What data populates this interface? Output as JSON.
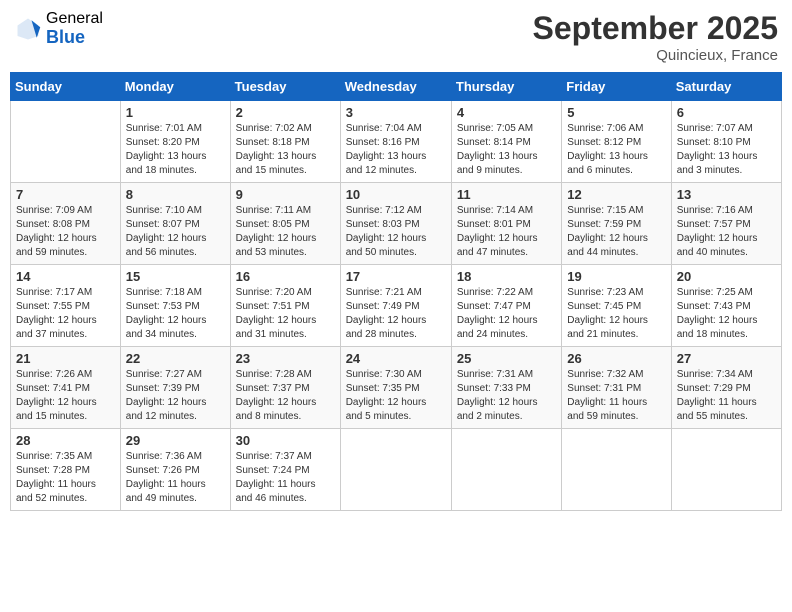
{
  "logo": {
    "general": "General",
    "blue": "Blue"
  },
  "title": "September 2025",
  "location": "Quincieux, France",
  "days_header": [
    "Sunday",
    "Monday",
    "Tuesday",
    "Wednesday",
    "Thursday",
    "Friday",
    "Saturday"
  ],
  "weeks": [
    [
      {
        "day": "",
        "info": ""
      },
      {
        "day": "1",
        "info": "Sunrise: 7:01 AM\nSunset: 8:20 PM\nDaylight: 13 hours\nand 18 minutes."
      },
      {
        "day": "2",
        "info": "Sunrise: 7:02 AM\nSunset: 8:18 PM\nDaylight: 13 hours\nand 15 minutes."
      },
      {
        "day": "3",
        "info": "Sunrise: 7:04 AM\nSunset: 8:16 PM\nDaylight: 13 hours\nand 12 minutes."
      },
      {
        "day": "4",
        "info": "Sunrise: 7:05 AM\nSunset: 8:14 PM\nDaylight: 13 hours\nand 9 minutes."
      },
      {
        "day": "5",
        "info": "Sunrise: 7:06 AM\nSunset: 8:12 PM\nDaylight: 13 hours\nand 6 minutes."
      },
      {
        "day": "6",
        "info": "Sunrise: 7:07 AM\nSunset: 8:10 PM\nDaylight: 13 hours\nand 3 minutes."
      }
    ],
    [
      {
        "day": "7",
        "info": "Sunrise: 7:09 AM\nSunset: 8:08 PM\nDaylight: 12 hours\nand 59 minutes."
      },
      {
        "day": "8",
        "info": "Sunrise: 7:10 AM\nSunset: 8:07 PM\nDaylight: 12 hours\nand 56 minutes."
      },
      {
        "day": "9",
        "info": "Sunrise: 7:11 AM\nSunset: 8:05 PM\nDaylight: 12 hours\nand 53 minutes."
      },
      {
        "day": "10",
        "info": "Sunrise: 7:12 AM\nSunset: 8:03 PM\nDaylight: 12 hours\nand 50 minutes."
      },
      {
        "day": "11",
        "info": "Sunrise: 7:14 AM\nSunset: 8:01 PM\nDaylight: 12 hours\nand 47 minutes."
      },
      {
        "day": "12",
        "info": "Sunrise: 7:15 AM\nSunset: 7:59 PM\nDaylight: 12 hours\nand 44 minutes."
      },
      {
        "day": "13",
        "info": "Sunrise: 7:16 AM\nSunset: 7:57 PM\nDaylight: 12 hours\nand 40 minutes."
      }
    ],
    [
      {
        "day": "14",
        "info": "Sunrise: 7:17 AM\nSunset: 7:55 PM\nDaylight: 12 hours\nand 37 minutes."
      },
      {
        "day": "15",
        "info": "Sunrise: 7:18 AM\nSunset: 7:53 PM\nDaylight: 12 hours\nand 34 minutes."
      },
      {
        "day": "16",
        "info": "Sunrise: 7:20 AM\nSunset: 7:51 PM\nDaylight: 12 hours\nand 31 minutes."
      },
      {
        "day": "17",
        "info": "Sunrise: 7:21 AM\nSunset: 7:49 PM\nDaylight: 12 hours\nand 28 minutes."
      },
      {
        "day": "18",
        "info": "Sunrise: 7:22 AM\nSunset: 7:47 PM\nDaylight: 12 hours\nand 24 minutes."
      },
      {
        "day": "19",
        "info": "Sunrise: 7:23 AM\nSunset: 7:45 PM\nDaylight: 12 hours\nand 21 minutes."
      },
      {
        "day": "20",
        "info": "Sunrise: 7:25 AM\nSunset: 7:43 PM\nDaylight: 12 hours\nand 18 minutes."
      }
    ],
    [
      {
        "day": "21",
        "info": "Sunrise: 7:26 AM\nSunset: 7:41 PM\nDaylight: 12 hours\nand 15 minutes."
      },
      {
        "day": "22",
        "info": "Sunrise: 7:27 AM\nSunset: 7:39 PM\nDaylight: 12 hours\nand 12 minutes."
      },
      {
        "day": "23",
        "info": "Sunrise: 7:28 AM\nSunset: 7:37 PM\nDaylight: 12 hours\nand 8 minutes."
      },
      {
        "day": "24",
        "info": "Sunrise: 7:30 AM\nSunset: 7:35 PM\nDaylight: 12 hours\nand 5 minutes."
      },
      {
        "day": "25",
        "info": "Sunrise: 7:31 AM\nSunset: 7:33 PM\nDaylight: 12 hours\nand 2 minutes."
      },
      {
        "day": "26",
        "info": "Sunrise: 7:32 AM\nSunset: 7:31 PM\nDaylight: 11 hours\nand 59 minutes."
      },
      {
        "day": "27",
        "info": "Sunrise: 7:34 AM\nSunset: 7:29 PM\nDaylight: 11 hours\nand 55 minutes."
      }
    ],
    [
      {
        "day": "28",
        "info": "Sunrise: 7:35 AM\nSunset: 7:28 PM\nDaylight: 11 hours\nand 52 minutes."
      },
      {
        "day": "29",
        "info": "Sunrise: 7:36 AM\nSunset: 7:26 PM\nDaylight: 11 hours\nand 49 minutes."
      },
      {
        "day": "30",
        "info": "Sunrise: 7:37 AM\nSunset: 7:24 PM\nDaylight: 11 hours\nand 46 minutes."
      },
      {
        "day": "",
        "info": ""
      },
      {
        "day": "",
        "info": ""
      },
      {
        "day": "",
        "info": ""
      },
      {
        "day": "",
        "info": ""
      }
    ]
  ]
}
